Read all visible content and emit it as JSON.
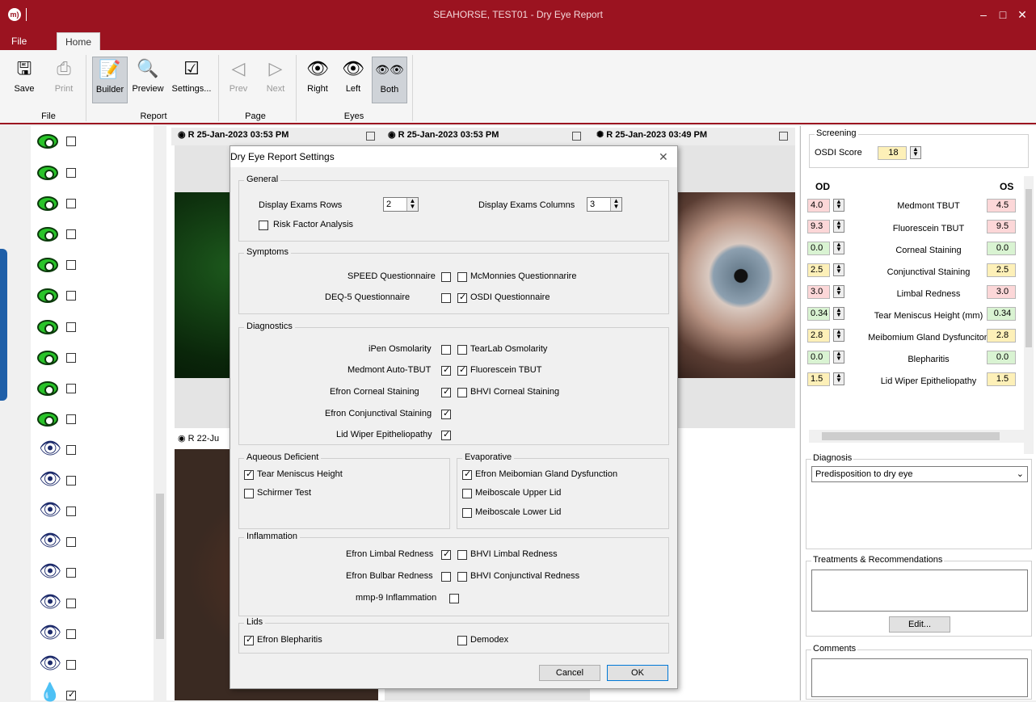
{
  "window": {
    "title": "SEAHORSE, TEST01 - Dry Eye Report",
    "logo": "m)"
  },
  "menu": {
    "file": "File",
    "home": "Home"
  },
  "ribbon": {
    "save": "Save",
    "print": "Print",
    "builder": "Builder",
    "preview": "Preview",
    "settings": "Settings...",
    "prev": "Prev",
    "next": "Next",
    "right": "Right",
    "left": "Left",
    "both": "Both",
    "groups": {
      "file": "File",
      "report": "Report",
      "page": "Page",
      "eyes": "Eyes"
    }
  },
  "exams": {
    "h1": "R 25-Jan-2023 03:53 PM",
    "h2": "R 25-Jan-2023 03:53 PM",
    "h3": "R 25-Jan-2023 03:49 PM",
    "h4": "R 22-Ju"
  },
  "screening": {
    "legend": "Screening",
    "osdi_label": "OSDI Score",
    "osdi_value": "18"
  },
  "measurements": {
    "od": "OD",
    "os": "OS",
    "rows": [
      {
        "label": "Medmont TBUT",
        "od": "4.0",
        "os": "4.5",
        "status": "red"
      },
      {
        "label": "Fluorescein TBUT",
        "od": "9.3",
        "os": "9.5",
        "status": "red"
      },
      {
        "label": "Corneal Staining",
        "od": "0.0",
        "os": "0.0",
        "status": "green"
      },
      {
        "label": "Conjunctival Staining",
        "od": "2.5",
        "os": "2.5",
        "status": "yellow"
      },
      {
        "label": "Limbal Redness",
        "od": "3.0",
        "os": "3.0",
        "status": "red"
      },
      {
        "label": "Tear Meniscus Height (mm)",
        "od": "0.34",
        "os": "0.34",
        "status": "green"
      },
      {
        "label": "Meibomium Gland Dysfunciton",
        "od": "2.8",
        "os": "2.8",
        "status": "yellow"
      },
      {
        "label": "Blepharitis",
        "od": "0.0",
        "os": "0.0",
        "status": "green"
      },
      {
        "label": "Lid Wiper Epitheliopathy",
        "od": "1.5",
        "os": "1.5",
        "status": "yellow"
      }
    ]
  },
  "diagnosis": {
    "legend": "Diagnosis",
    "value": "Predisposition to dry eye"
  },
  "treatments": {
    "legend": "Treatments & Recommendations",
    "edit": "Edit..."
  },
  "comments": {
    "legend": "Comments"
  },
  "dialog": {
    "title": "Dry Eye Report Settings",
    "general": {
      "legend": "General",
      "rows_label": "Display Exams Rows",
      "rows_value": "2",
      "cols_label": "Display Exams Columns",
      "cols_value": "3",
      "risk": "Risk Factor Analysis"
    },
    "symptoms": {
      "legend": "Symptoms",
      "speed": "SPEED Questionnaire",
      "mcmonnies": "McMonnies Questionnarire",
      "deq5": "DEQ-5 Questionnaire",
      "osdi": "OSDI Questionnaire"
    },
    "diagnostics": {
      "legend": "Diagnostics",
      "ipen": "iPen Osmolarity",
      "tearlab": "TearLab Osmolarity",
      "medmont": "Medmont Auto-TBUT",
      "fluorescein": "Fluorescein TBUT",
      "efron_corneal": "Efron Corneal Staining",
      "bhvi_corneal": "BHVI Corneal Staining",
      "efron_conj": "Efron Conjunctival Staining",
      "lid_wiper": "Lid Wiper Epitheliopathy"
    },
    "aqueous": {
      "legend": "Aqueous Deficient",
      "tear": "Tear Meniscus Height",
      "schirmer": "Schirmer Test"
    },
    "evaporative": {
      "legend": "Evaporative",
      "efron_mgd": "Efron Meibomian Gland Dysfunction",
      "upper": "Meiboscale Upper Lid",
      "lower": "Meiboscale Lower Lid"
    },
    "inflammation": {
      "legend": "Inflammation",
      "efron_limbal": "Efron Limbal Redness",
      "bhvi_limbal": "BHVI Limbal Redness",
      "efron_bulbar": "Efron Bulbar Redness",
      "bhvi_conj": "BHVI Conjunctival Redness",
      "mmp9": "mmp-9 Inflammation"
    },
    "lids": {
      "legend": "Lids",
      "efron_bleph": "Efron Blepharitis",
      "demodex": "Demodex"
    },
    "cancel": "Cancel",
    "ok": "OK"
  },
  "colors": {
    "brand": "#9b1320",
    "red": "#fcd7d8",
    "green": "#d9f3d2",
    "yellow": "#fdf0b8"
  }
}
